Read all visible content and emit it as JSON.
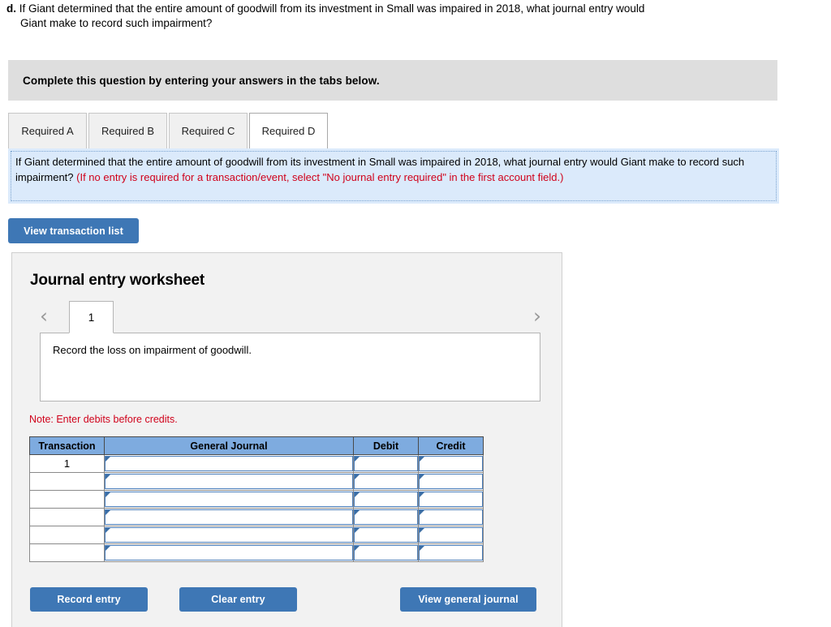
{
  "question": {
    "letter": "d.",
    "line1": "If Giant determined that the entire amount of goodwill from its investment in Small was impaired in 2018, what journal entry would",
    "line2": "Giant make to record such impairment?"
  },
  "instruction_bar": {
    "text": "Complete this question by entering your answers in the tabs below."
  },
  "tabs": [
    {
      "label": "Required A",
      "active": false
    },
    {
      "label": "Required B",
      "active": false
    },
    {
      "label": "Required C",
      "active": false
    },
    {
      "label": "Required D",
      "active": true
    }
  ],
  "requirement_panel": {
    "black_text": "If Giant determined that the entire amount of goodwill from its investment in Small was impaired in 2018, what journal entry would Giant make to record such impairment? ",
    "red_text": "(If no entry is required for a transaction/event, select \"No journal entry required\" in the first account field.)"
  },
  "view_transaction_list_button": {
    "label": "View transaction list"
  },
  "worksheet": {
    "title": "Journal entry worksheet",
    "pager": {
      "prev_icon": "chevron-left-icon",
      "next_icon": "chevron-right-icon",
      "current_page": "1"
    },
    "description": "Record the loss on impairment of goodwill.",
    "note": "Note: Enter debits before credits.",
    "table": {
      "headers": [
        "Transaction",
        "General Journal",
        "Debit",
        "Credit"
      ],
      "rows": [
        {
          "transaction": "1",
          "general_journal": "",
          "debit": "",
          "credit": ""
        },
        {
          "transaction": "",
          "general_journal": "",
          "debit": "",
          "credit": ""
        },
        {
          "transaction": "",
          "general_journal": "",
          "debit": "",
          "credit": ""
        },
        {
          "transaction": "",
          "general_journal": "",
          "debit": "",
          "credit": ""
        },
        {
          "transaction": "",
          "general_journal": "",
          "debit": "",
          "credit": ""
        },
        {
          "transaction": "",
          "general_journal": "",
          "debit": "",
          "credit": ""
        }
      ]
    },
    "buttons": {
      "record_entry": "Record entry",
      "clear_entry": "Clear entry",
      "view_general_journal": "View general journal"
    }
  },
  "colors": {
    "button_blue": "#3e77b5",
    "table_header_blue": "#7eabdf",
    "panel_blue": "#dbeafb",
    "instruction_gray": "#dedede",
    "alert_red": "#d0021b"
  }
}
